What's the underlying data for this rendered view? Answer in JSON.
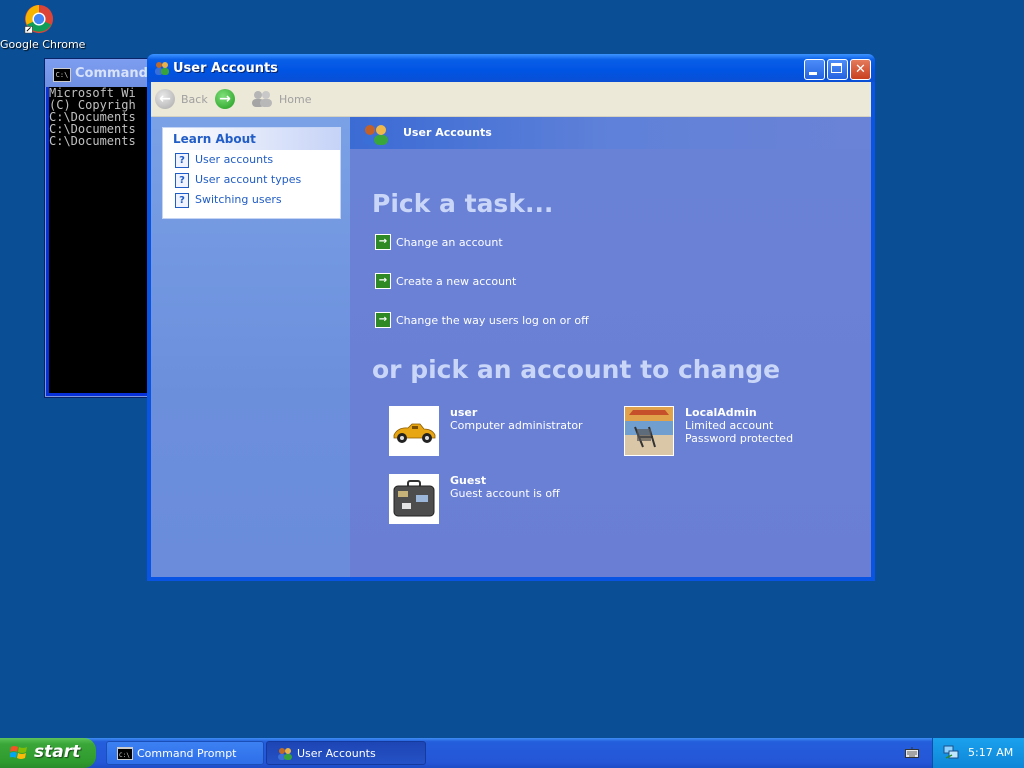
{
  "desktop": {
    "icons": [
      {
        "label": "Google Chrome",
        "icon": "chrome-icon"
      }
    ]
  },
  "cmd_window": {
    "title": "Command P",
    "lines": [
      "Microsoft Wi",
      "(C) Copyrigh",
      "",
      "C:\\Documents",
      "",
      "C:\\Documents",
      "",
      "C:\\Documents"
    ]
  },
  "window": {
    "title": "User Accounts",
    "toolbar": {
      "back_label": "Back",
      "home_label": "Home"
    },
    "learn_about": {
      "heading": "Learn About",
      "items": [
        {
          "label": "User accounts"
        },
        {
          "label": "User account types"
        },
        {
          "label": "Switching users"
        }
      ]
    },
    "header_title": "User Accounts",
    "pick_task_heading": "Pick a task...",
    "tasks": [
      {
        "label": "Change an account"
      },
      {
        "label": "Create a new account"
      },
      {
        "label": "Change the way users log on or off"
      }
    ],
    "pick_account_heading": "or pick an account to change",
    "accounts": [
      {
        "name": "user",
        "line1": "Computer administrator",
        "line2": "",
        "picture": "race-car"
      },
      {
        "name": "LocalAdmin",
        "line1": "Limited account",
        "line2": "Password protected",
        "picture": "beach-chairs"
      },
      {
        "name": "Guest",
        "line1": "Guest account is off",
        "line2": "",
        "picture": "suitcase"
      }
    ]
  },
  "taskbar": {
    "start_label": "start",
    "tasks": [
      {
        "label": "Command Prompt",
        "active": false
      },
      {
        "label": "User Accounts",
        "active": true
      }
    ],
    "clock": "5:17 AM"
  },
  "colors": {
    "desktop": "#0a4f96",
    "title_bar": "#0054e3",
    "task_green": "#2f8a25",
    "link_blue": "#215dc6"
  }
}
